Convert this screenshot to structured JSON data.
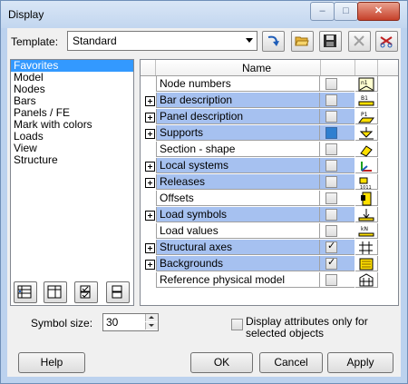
{
  "window": {
    "title": "Display"
  },
  "template": {
    "label": "Template:",
    "value": "Standard"
  },
  "categories": [
    "Favorites",
    "Model",
    "Nodes",
    "Bars",
    "Panels / FE",
    "Mark with colors",
    "Loads",
    "View",
    "Structure"
  ],
  "grid": {
    "header": "Name",
    "rows": [
      {
        "name": "Node numbers",
        "expandable": false,
        "highlight": false,
        "checked": false,
        "icon": "node-numbers-icon"
      },
      {
        "name": "Bar description",
        "expandable": true,
        "highlight": true,
        "checked": false,
        "icon": "bar-description-icon"
      },
      {
        "name": "Panel description",
        "expandable": true,
        "highlight": true,
        "checked": false,
        "icon": "panel-description-icon"
      },
      {
        "name": "Supports",
        "expandable": true,
        "highlight": true,
        "checked": false,
        "filled": true,
        "icon": "supports-icon"
      },
      {
        "name": "Section - shape",
        "expandable": false,
        "highlight": false,
        "checked": false,
        "icon": "section-shape-icon"
      },
      {
        "name": "Local systems",
        "expandable": true,
        "highlight": true,
        "checked": false,
        "icon": "local-systems-icon"
      },
      {
        "name": "Releases",
        "expandable": true,
        "highlight": true,
        "checked": false,
        "icon": "releases-icon"
      },
      {
        "name": "Offsets",
        "expandable": false,
        "highlight": false,
        "checked": false,
        "icon": "offsets-icon"
      },
      {
        "name": "Load symbols",
        "expandable": true,
        "highlight": true,
        "checked": false,
        "icon": "load-symbols-icon"
      },
      {
        "name": "Load values",
        "expandable": false,
        "highlight": false,
        "checked": false,
        "icon": "load-values-icon"
      },
      {
        "name": "Structural axes",
        "expandable": true,
        "highlight": true,
        "checked": true,
        "icon": "structural-axes-icon"
      },
      {
        "name": "Backgrounds",
        "expandable": true,
        "highlight": true,
        "checked": true,
        "icon": "backgrounds-icon"
      },
      {
        "name": "Reference physical model",
        "expandable": false,
        "highlight": false,
        "checked": false,
        "icon": "physical-model-icon"
      }
    ]
  },
  "symbol_size": {
    "label": "Symbol size:",
    "value": "30"
  },
  "display_selected": {
    "label_line1": "Display attributes only for",
    "label_line2": "selected objects",
    "checked": false
  },
  "buttons": {
    "help": "Help",
    "ok": "OK",
    "cancel": "Cancel",
    "apply": "Apply"
  },
  "colors": {
    "selection": "#3399ff",
    "row_highlight": "#a6c1f0",
    "close_button": "#c6402a"
  }
}
